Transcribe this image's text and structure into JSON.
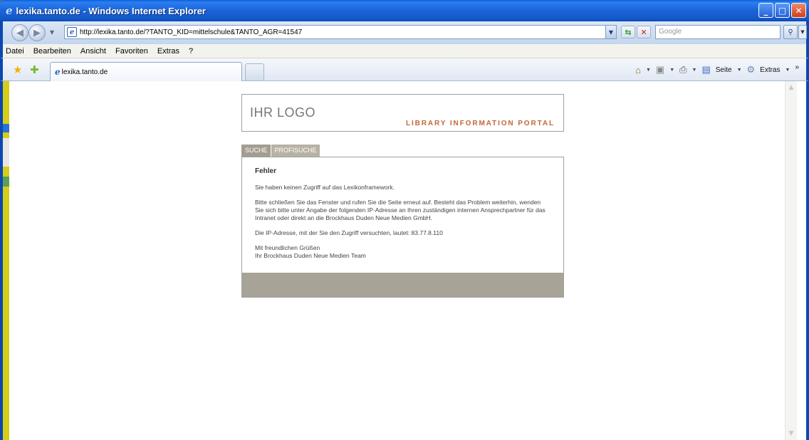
{
  "window": {
    "title": "lexika.tanto.de - Windows Internet Explorer"
  },
  "address": {
    "url": "http://lexika.tanto.de/?TANTO_KID=mittelschule&TANTO_AGR=41547",
    "search_placeholder": "Google"
  },
  "menu": {
    "items": [
      "Datei",
      "Bearbeiten",
      "Ansicht",
      "Favoriten",
      "Extras",
      "?"
    ]
  },
  "tabs": {
    "active_label": "lexika.tanto.de"
  },
  "commandbar": {
    "page_label": "Seite",
    "tools_label": "Extras"
  },
  "portal": {
    "logo": "IHR LOGO",
    "tagline": "LIBRARY INFORMATION PORTAL",
    "tabs": [
      "SUCHE",
      "PROFISUCHE"
    ],
    "error": {
      "heading": "Fehler",
      "p1": "Sie haben keinen Zugriff auf das Lexikonframework.",
      "p2": "Bitte schließen Sie das Fenster und rufen Sie die Seite erneut auf. Besteht das Problem weiterhin, wenden Sie sich bitte unter Angabe der folgenden IP-Adresse an Ihren zuständigen internen Ansprechpartner für das Intranet oder direkt an die Brockhaus Duden Neue Medien GmbH.",
      "p3": "Die IP-Adresse, mit der Sie den Zugriff versuchten, lautet: 83.77.8.110",
      "greeting": "Mit freundlichen Grüßen",
      "signature": "Ihr Brockhaus Duden Neue Medien Team"
    }
  },
  "icons": {
    "back": "back-arrow-icon",
    "forward": "forward-arrow-icon",
    "refresh": "refresh-icon",
    "stop": "stop-icon",
    "search": "search-icon",
    "favorites": "star-icon",
    "add_favorite": "add-favorite-icon",
    "home": "home-icon",
    "feeds": "feed-icon",
    "print": "print-icon",
    "page": "page-icon",
    "tools": "gear-icon"
  }
}
